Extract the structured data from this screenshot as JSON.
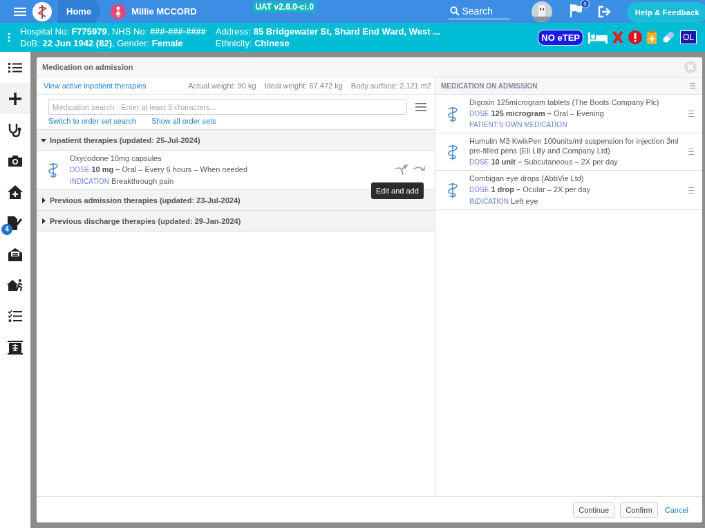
{
  "header": {
    "home": "Home",
    "patient_name": "Millie MCCORD",
    "environment": "UAT v2.6.0-ci.0",
    "search": "Search",
    "flag_count": "6",
    "help": "Help & Feedback"
  },
  "patient_banner": {
    "left": [
      "Hospital No: **F775979**, NHS No: **###-###-####**",
      "DoB: **22 Jun 1942 (82)**, Gender: **Female**"
    ],
    "right": [
      "Address: **85 Bridgewater St, Shard End Ward, West ...**",
      "Ethnicity: **Chinese**"
    ],
    "tags": [
      {
        "kind": "pill",
        "text": "NO eTEP"
      },
      {
        "kind": "bed"
      },
      {
        "kind": "cross"
      },
      {
        "kind": "alert"
      },
      {
        "kind": "clipboard"
      },
      {
        "kind": "capsule"
      },
      {
        "kind": "box",
        "text": "OL"
      }
    ]
  },
  "sidebar": [
    {
      "kind": "list",
      "selected": false
    },
    {
      "kind": "plus",
      "selected": true
    },
    {
      "kind": "stethoscope",
      "selected": false
    },
    {
      "kind": "camera",
      "selected": false
    },
    {
      "kind": "house",
      "selected": false
    },
    {
      "kind": "note",
      "selected": false,
      "badge": "4"
    },
    {
      "kind": "mail",
      "selected": false
    },
    {
      "kind": "exit",
      "selected": false
    },
    {
      "kind": "checklist",
      "selected": false
    },
    {
      "kind": "board",
      "selected": false
    }
  ],
  "modal": {
    "title": "Medication on admission",
    "view_link": "View active inpatient therapies",
    "measures": [
      "Actual weight: 90 kg",
      "Ideal weight: 67.472 kg",
      "Body surface: 2.121 m2"
    ],
    "search_placeholder": "Medication search - Enter at least 3 characters...",
    "links": [
      "Switch to order set search",
      "Show all order sets"
    ],
    "sections": [
      {
        "title": "Inpatient therapies (updated: 25-Jul-2024)",
        "expanded": true,
        "items": [
          {
            "name": "Oxycodone 10mg capsules",
            "dose_label": "DOSE",
            "dose": "**10 mg –** Oral – Every 6 hours – When needed",
            "indication_label": "INDICATION",
            "indication": "Breakthrough pain",
            "tooltip": "Edit and add"
          }
        ]
      },
      {
        "title": "Previous admission therapies (updated: 23-Jul-2024)",
        "expanded": false
      },
      {
        "title": "Previous discharge therapies (updated: 29-Jan-2024)",
        "expanded": false
      }
    ],
    "right_heading": "MEDICATION ON ADMISSION",
    "admission_items": [
      {
        "name": "Digoxin 125microgram tablets (The Boots Company Plc)",
        "dose_label": "DOSE",
        "dose": "**125 microgram –** Oral – Evening",
        "note": "PATIENT'S OWN MEDICATION"
      },
      {
        "name": "Humulin M3 KwikPen 100units/ml suspension for injection 3ml pre-filled pens (Eli Lilly and Company Ltd)",
        "dose_label": "DOSE",
        "dose": "**10 unit –** Subcutaneous – 2X per day"
      },
      {
        "name": "Combigan eye drops (AbbVie Ltd)",
        "dose_label": "DOSE",
        "dose": "**1 drop –** Ocular – 2X per day",
        "indication_label": "INDICATION",
        "indication": "Left eye"
      }
    ],
    "buttons": [
      {
        "kind": "button",
        "label": "Continue"
      },
      {
        "kind": "button",
        "label": "Confirm"
      },
      {
        "kind": "link",
        "label": "Cancel"
      }
    ]
  }
}
